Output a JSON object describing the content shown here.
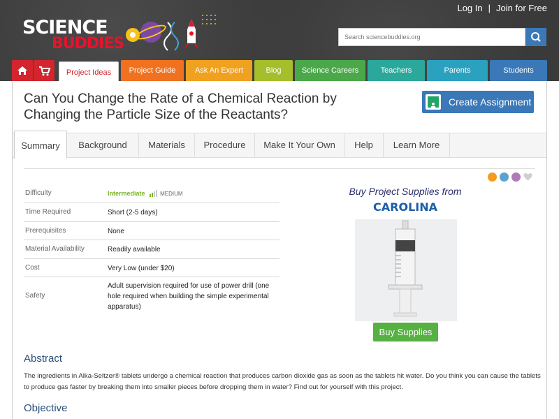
{
  "header": {
    "logo_line1": "SCIENCE",
    "logo_line2": "BUDDIES",
    "login": "Log In",
    "separator": "|",
    "join": "Join for Free",
    "search_placeholder": "Search sciencebuddies.org"
  },
  "nav": {
    "items": [
      {
        "label": "",
        "icon": "home-icon",
        "color": "#d2252e"
      },
      {
        "label": "",
        "icon": "cart-icon",
        "color": "#d2252e"
      },
      {
        "label": "Project Ideas",
        "color": "#ffffff"
      },
      {
        "label": "Project Guide",
        "color": "#f0711f"
      },
      {
        "label": "Ask An Expert",
        "color": "#f0a120"
      },
      {
        "label": "Blog",
        "color": "#a4be2c"
      },
      {
        "label": "Science Careers",
        "color": "#4aa84a"
      },
      {
        "label": "Teachers",
        "color": "#2ba89c"
      },
      {
        "label": "Parents",
        "color": "#2ba1c0"
      },
      {
        "label": "Students",
        "color": "#3a78b8"
      }
    ]
  },
  "page": {
    "title_line1": "Can You Change the Rate of a Chemical Reaction by",
    "title_line2": "Changing the Particle Size of the Reactants?",
    "create_assignment": "Create Assignment"
  },
  "tabs": [
    "Summary",
    "Background",
    "Materials",
    "Procedure",
    "Make It Your Own",
    "Help",
    "Learn More"
  ],
  "info": [
    {
      "label": "Difficulty",
      "value": "Intermediate",
      "extra": "MEDIUM"
    },
    {
      "label": "Time Required",
      "value": "Short (2-5 days)"
    },
    {
      "label": "Prerequisites",
      "value": "None"
    },
    {
      "label": "Material Availability",
      "value": "Readily available"
    },
    {
      "label": "Cost",
      "value": "Very Low (under $20)"
    },
    {
      "label": "Safety",
      "value": "Adult supervision required for use of power drill (one hole required when building the simple experimental apparatus)"
    }
  ],
  "supplies": {
    "title": "Buy Project Supplies from",
    "brand": "CAROLINA",
    "button": "Buy Supplies"
  },
  "abstract": {
    "heading": "Abstract",
    "text": "The ingredients in Alka-Seltzer® tablets undergo a chemical reaction that produces carbon dioxide gas as soon as the tablets hit water. Do you think you can cause the tablets to produce gas faster by breaking them into smaller pieces before dropping them in water? Find out for yourself with this project."
  },
  "objective": {
    "heading": "Objective"
  }
}
